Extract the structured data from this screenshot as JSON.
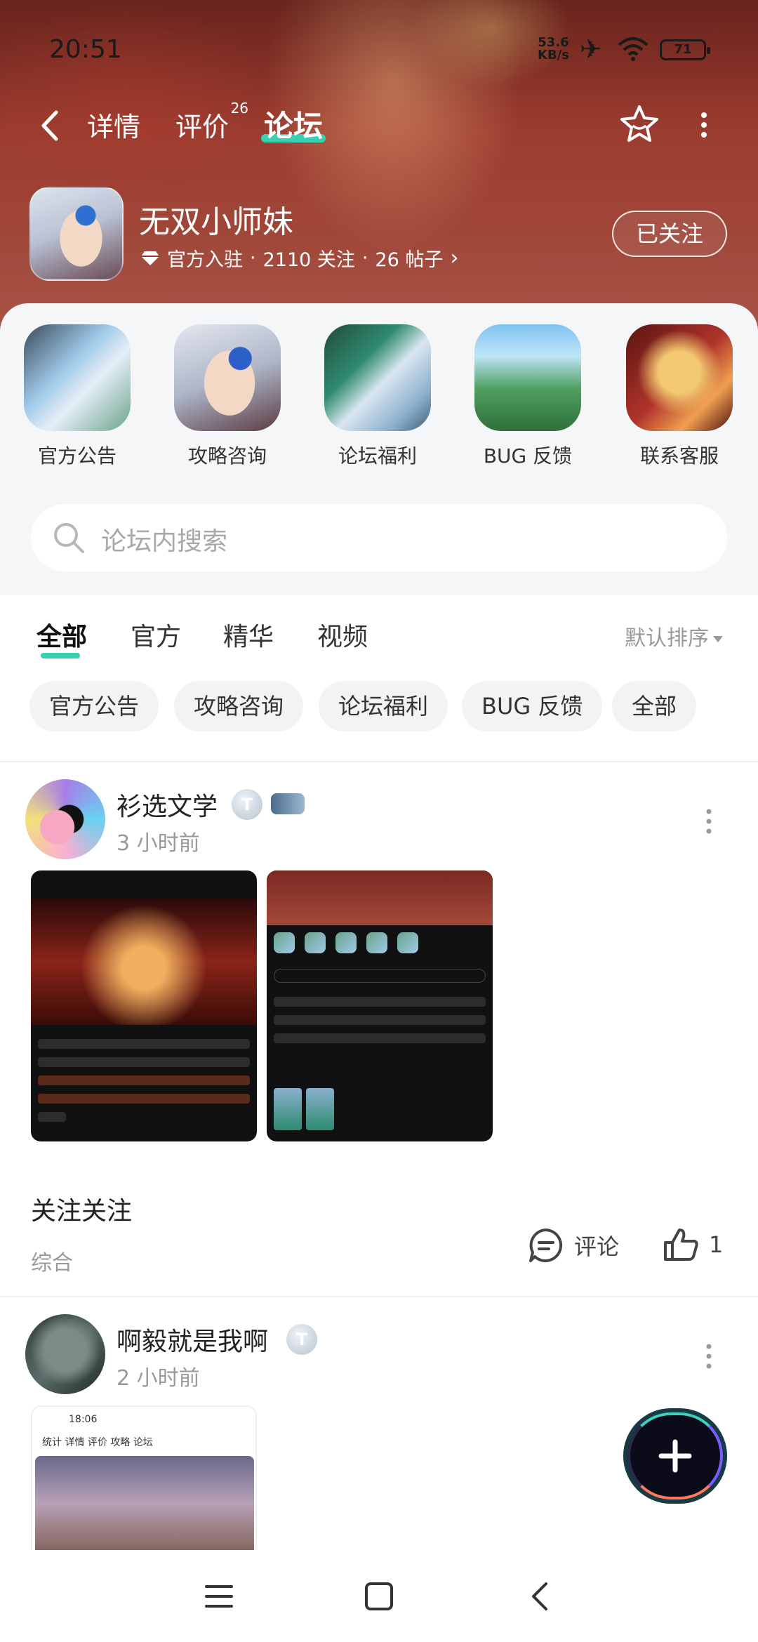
{
  "status": {
    "time": "20:51",
    "speed_value": "53.6",
    "speed_unit": "KB/s",
    "battery": "71"
  },
  "nav": {
    "tabs": [
      "详情",
      "评价",
      "论坛"
    ],
    "review_count": "26",
    "active_tab": "论坛"
  },
  "profile": {
    "name": "无双小师妹",
    "official": "官方入驻",
    "follows": "2110 关注",
    "posts": "26 帖子",
    "follow_button": "已关注"
  },
  "categories": [
    {
      "label": "官方公告"
    },
    {
      "label": "攻略咨询"
    },
    {
      "label": "论坛福利"
    },
    {
      "label": "BUG 反馈"
    },
    {
      "label": "联系客服"
    }
  ],
  "search": {
    "placeholder": "论坛内搜索"
  },
  "feed_tabs": {
    "items": [
      "全部",
      "官方",
      "精华",
      "视频"
    ],
    "active": "全部",
    "sort": "默认排序"
  },
  "chips": [
    "官方公告",
    "攻略咨询",
    "论坛福利",
    "BUG 反馈",
    "全部"
  ],
  "posts": [
    {
      "user": "衫选文学",
      "badge": "T",
      "time": "3 小时前",
      "content": "关注关注",
      "tag": "综合",
      "comment_label": "评论",
      "likes": "1"
    },
    {
      "user": "啊毅就是我啊",
      "badge": "T",
      "time": "2 小时前",
      "shot_time": "18:06",
      "shot_nav": "统计  详情  评价  攻略  论坛"
    }
  ],
  "colors": {
    "accent": "#36d1b0",
    "hero": "#9a3a2e"
  }
}
